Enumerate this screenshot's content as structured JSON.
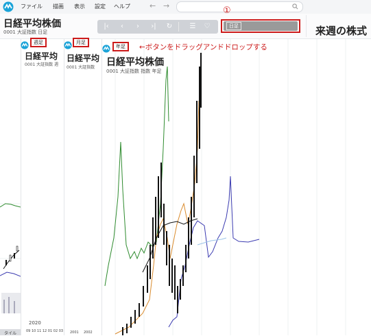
{
  "menu": {
    "items": [
      "ファイル",
      "描画",
      "表示",
      "設定",
      "ヘルプ"
    ]
  },
  "toolbar": {
    "title": "日経平均株価",
    "subtitle": "0001 大証指数 日足",
    "timeframe_value": "日足",
    "step_marker": "①",
    "next_week_title": "来週の株式"
  },
  "panels": {
    "weekly": {
      "badge": "週足",
      "title": "日経平均",
      "subtitle": "0001 大証指数 週",
      "year_label": "2020",
      "date_label": "09 10 11 12 01 02 03"
    },
    "monthly": {
      "badge": "月足",
      "title": "日経平均",
      "subtitle": "0001 大証指数",
      "axis_labels": [
        "2001",
        "2002"
      ]
    },
    "yearly": {
      "badge": "年足",
      "title": "日経平均株価",
      "subtitle": "0001 大証指数 指数 年足"
    }
  },
  "instruction": "←ボタンをドラッグアンドドロップする",
  "left_panel": {
    "bottom_label": "タイル"
  },
  "colors": {
    "accent_red": "#cc1a1a",
    "green_line": "#2e8b2e",
    "blue_line": "#3a3ab0",
    "orange_line": "#d98a2b",
    "candle": "#111111"
  },
  "icons": [
    "app-logo-icon",
    "back-arrow-icon",
    "forward-arrow-icon",
    "search-icon",
    "first-icon",
    "prev-icon",
    "next-icon",
    "last-icon",
    "refresh-icon",
    "list-icon",
    "heart-icon"
  ]
}
